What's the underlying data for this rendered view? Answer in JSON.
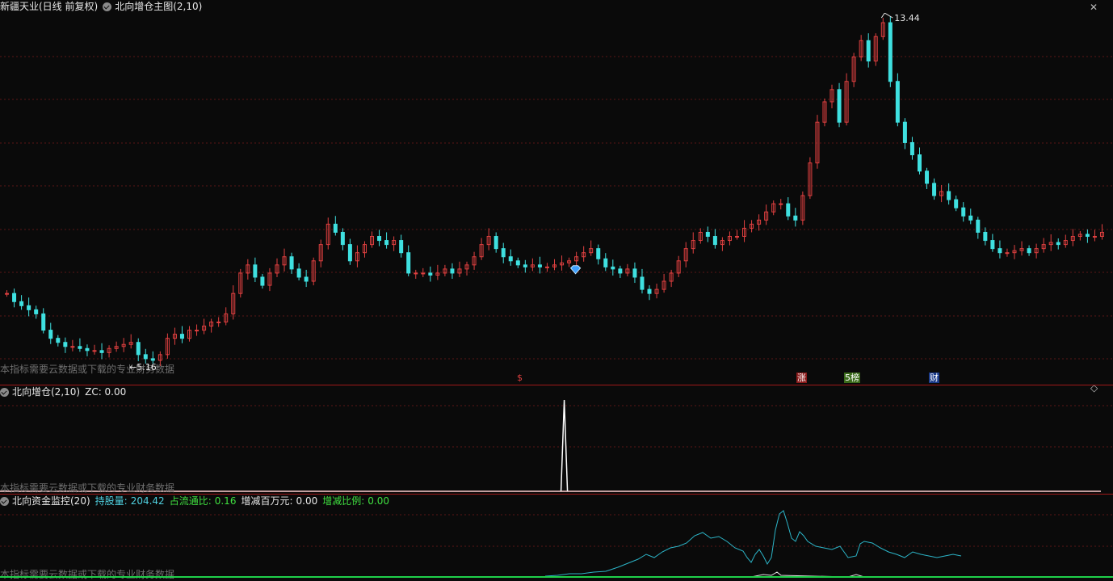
{
  "main_panel": {
    "stock_title": "新疆天业(日线 前复权)",
    "indicator_title": "北向增仓主图(2,10)",
    "high_label": "13.44",
    "low_label": "5.16",
    "hint": "本指标需要云数据或下载的专业财务数据",
    "markers": [
      "$",
      "涨",
      "5榜",
      "财"
    ]
  },
  "panel2": {
    "title": "北向增仓(2,10)",
    "zc": "ZC: 0.00",
    "hint": "本指标需要云数据或下载的专业财务数据"
  },
  "panel3": {
    "title": "北向资金监控(20)",
    "holdings_label": "持股量:",
    "holdings_value": "204.42",
    "float_ratio_label": "占流通比:",
    "float_ratio_value": "0.16",
    "change_mm_label": "增减百万元:",
    "change_mm_value": "0.00",
    "change_ratio_label": "增减比例:",
    "change_ratio_value": "0.00",
    "hint": "本指标需要云数据或下载的专业财务数据"
  },
  "toolbar": {
    "close_glyph": "✕",
    "diamond_glyph": "◇"
  },
  "colors": {
    "up": "#e04040",
    "down": "#3fe0e0",
    "grid": "#5a1515",
    "sep": "#a01818",
    "line_cyan": "#2cb5c8",
    "line_white": "#ffffff"
  },
  "chart_data": {
    "type": "candlestick",
    "price_series": [
      6.8,
      6.6,
      6.5,
      6.4,
      6.3,
      5.9,
      5.7,
      5.6,
      5.5,
      5.5,
      5.45,
      5.4,
      5.4,
      5.35,
      5.45,
      5.5,
      5.55,
      5.6,
      5.3,
      5.2,
      5.16,
      5.3,
      5.7,
      5.8,
      5.7,
      5.9,
      5.9,
      6.0,
      6.1,
      6.1,
      6.3,
      6.8,
      7.3,
      7.5,
      7.2,
      7.0,
      7.3,
      7.5,
      7.7,
      7.4,
      7.2,
      7.1,
      7.6,
      8.0,
      8.5,
      8.3,
      8.0,
      7.6,
      7.8,
      8.0,
      8.2,
      8.1,
      8.0,
      8.1,
      7.8,
      7.3,
      7.3,
      7.3,
      7.25,
      7.3,
      7.4,
      7.3,
      7.4,
      7.5,
      7.7,
      8.0,
      8.2,
      7.9,
      7.7,
      7.6,
      7.5,
      7.45,
      7.5,
      7.45,
      7.45,
      7.5,
      7.55,
      7.6,
      7.7,
      7.8,
      7.9,
      7.65,
      7.45,
      7.4,
      7.3,
      7.4,
      7.2,
      6.9,
      6.8,
      6.9,
      7.1,
      7.3,
      7.6,
      7.9,
      8.1,
      8.3,
      8.2,
      8.0,
      8.1,
      8.2,
      8.2,
      8.4,
      8.5,
      8.6,
      8.8,
      9.0,
      9.0,
      8.7,
      8.6,
      9.2,
      10.0,
      11.0,
      11.5,
      11.8,
      11.0,
      12.0,
      12.6,
      13.0,
      12.5,
      13.1,
      13.44,
      12.0,
      11.0,
      10.5,
      10.2,
      9.8,
      9.5,
      9.2,
      9.3,
      9.1,
      8.9,
      8.7,
      8.6,
      8.3,
      8.1,
      7.9,
      7.8,
      7.8,
      7.85,
      7.9,
      7.8,
      7.9,
      8.0,
      8.05,
      8.0,
      8.1,
      8.2,
      8.25,
      8.2,
      8.2,
      8.3
    ],
    "ylim": [
      5.0,
      13.6
    ],
    "high": 13.44,
    "low": 5.16,
    "zc_value": 0.0,
    "zc_spike_index": 77,
    "holdings": 204.42,
    "float_ratio": 0.16,
    "change_mm": 0.0,
    "change_ratio": 0.0
  }
}
